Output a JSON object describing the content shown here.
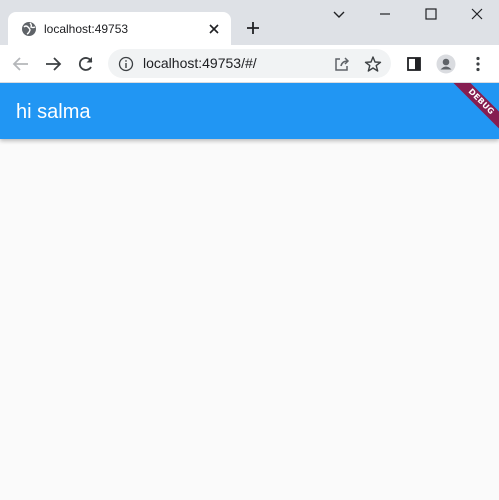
{
  "browser": {
    "tab": {
      "title": "localhost:49753",
      "favicon": "globe-icon",
      "close_icon": "close-icon"
    },
    "new_tab_icon": "plus-icon",
    "window_controls": [
      "chevron-down-icon",
      "minimize-icon",
      "maximize-icon",
      "close-icon"
    ],
    "toolbar": {
      "back_icon": "back-arrow-icon",
      "forward_icon": "forward-arrow-icon",
      "reload_icon": "reload-icon",
      "url": "localhost:49753/#/",
      "site_info_icon": "info-icon",
      "share_icon": "share-icon",
      "bookmark_icon": "star-icon",
      "side_panel_icon": "side-panel-icon",
      "profile_icon": "avatar-icon",
      "menu_icon": "kebab-menu-icon"
    }
  },
  "app": {
    "appbar_title": "hi salma",
    "debug_banner": "DEBUG",
    "colors": {
      "appbar": "#2196f3",
      "background": "#fafafa",
      "debug_banner": "#a00028"
    }
  }
}
